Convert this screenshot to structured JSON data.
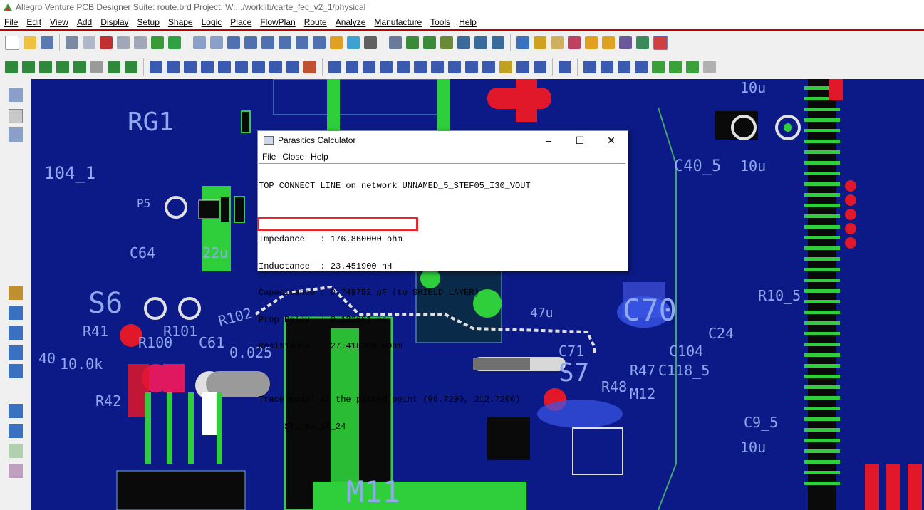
{
  "window": {
    "title": "Allegro Venture PCB Designer Suite: route.brd  Project: W:.../worklib/carte_fec_v2_1/physical"
  },
  "menubar": [
    "File",
    "Edit",
    "View",
    "Add",
    "Display",
    "Setup",
    "Shape",
    "Logic",
    "Place",
    "FlowPlan",
    "Route",
    "Analyze",
    "Manufacture",
    "Tools",
    "Help"
  ],
  "board_labels": {
    "rg1": "RG1",
    "l104": "104_1",
    "c64": "C64",
    "u22": "22u",
    "p5": "P5",
    "s6": "S6",
    "r41": "R41",
    "r101": "R101",
    "r100": "R100",
    "c61": "C61",
    "r102": "R102",
    "v025": "0.025",
    "r42": "R42",
    "c40_5": "C40_5",
    "u10a": "10u",
    "u10b": "10u",
    "u10c": "10u",
    "u47": "47u",
    "c70": "C70",
    "r10_5": "R10_5",
    "c24": "C24",
    "c104": "C104",
    "c118": "C118_5",
    "c71": "C71",
    "s7": "S7",
    "r47": "R47",
    "r48": "R48",
    "m12": "M12",
    "c9_5": "C9_5",
    "m11": "M11",
    "c40": "40",
    "k10": "10.0k"
  },
  "dialog": {
    "title": "Parasitics Calculator",
    "menu": [
      "File",
      "Close",
      "Help"
    ],
    "lines": [
      "TOP CONNECT LINE on network UNNAMED_5_STEF05_I30_VOUT",
      "",
      "Impedance   : 176.860000 ohm",
      "Inductance  : 23.451900 nH",
      "Capacitance : 0.749752 pF (to SHIELD LAYER)",
      "Prop Delay  : 0.132601 ns",
      "Resistance  : 27.418300 mOhm",
      "",
      "Trace model at the picked point (96.7200, 212.7200)",
      "     STL_0S_1R_24"
    ]
  },
  "colors": {
    "board": "#0b1a86",
    "trace_green": "#2ecf3a",
    "pad_red": "#e0182a",
    "highlight": "#e8262c",
    "menubar_accent": "#c00000"
  }
}
